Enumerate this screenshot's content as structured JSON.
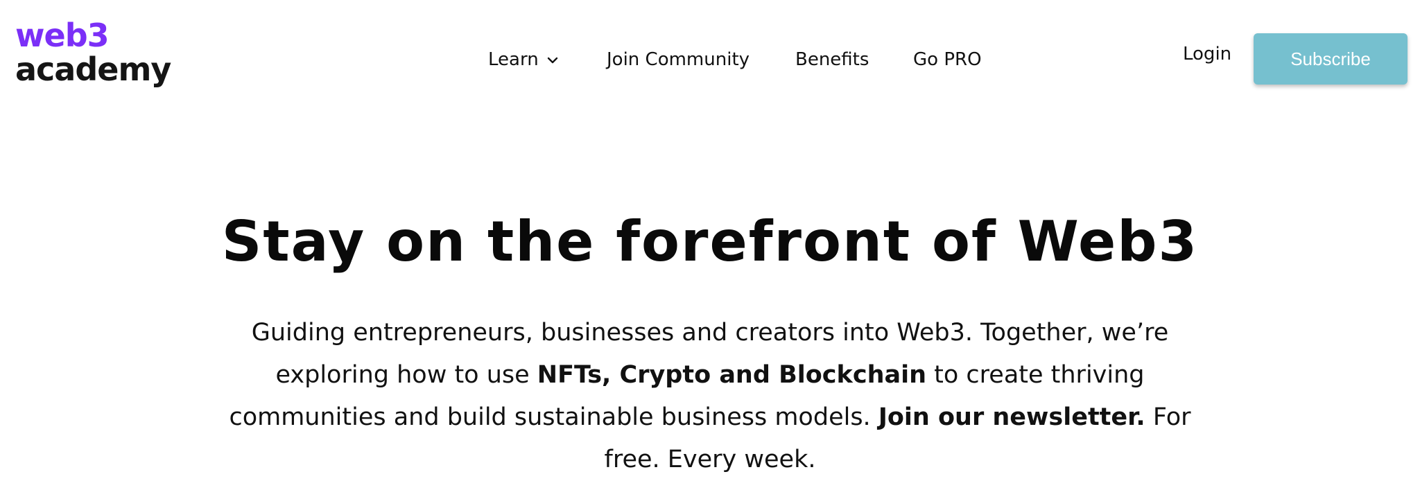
{
  "logo": {
    "line1": "web3",
    "line2": "academy"
  },
  "nav": {
    "learn": "Learn",
    "join_community": "Join Community",
    "benefits": "Benefits",
    "go_pro": "Go PRO"
  },
  "header": {
    "login": "Login",
    "subscribe": "Subscribe"
  },
  "hero": {
    "title": "Stay on the forefront of Web3",
    "p1": "Guiding entrepreneurs, businesses and creators into Web3. Together, we’re exploring how to use ",
    "bold1": "NFTs, Crypto and Blockchain",
    "p2": " to create thriving communities and build sustainable business models. ",
    "bold2": "Join our newsletter.",
    "p3": " For free. Every week."
  },
  "colors": {
    "brand_purple": "#7b2ff7",
    "subscribe_bg": "#76c0cf"
  }
}
